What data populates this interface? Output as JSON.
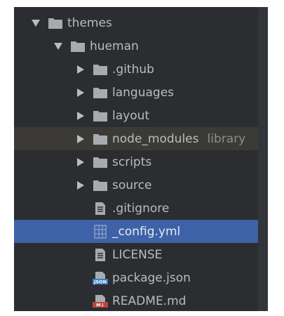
{
  "tree": {
    "items": [
      {
        "label": "themes",
        "type": "folder",
        "expanded": true,
        "depth": 0
      },
      {
        "label": "hueman",
        "type": "folder",
        "expanded": true,
        "depth": 1
      },
      {
        "label": ".github",
        "type": "folder",
        "expanded": false,
        "depth": 2
      },
      {
        "label": "languages",
        "type": "folder",
        "expanded": false,
        "depth": 2
      },
      {
        "label": "layout",
        "type": "folder",
        "expanded": false,
        "depth": 2
      },
      {
        "label": "node_modules",
        "hint": "library",
        "type": "folder",
        "expanded": false,
        "depth": 2
      },
      {
        "label": "scripts",
        "type": "folder",
        "expanded": false,
        "depth": 2
      },
      {
        "label": "source",
        "type": "folder",
        "expanded": false,
        "depth": 2
      },
      {
        "label": ".gitignore",
        "type": "file-text",
        "depth": 2
      },
      {
        "label": "_config.yml",
        "type": "file-yml",
        "depth": 2,
        "selected": true
      },
      {
        "label": "LICENSE",
        "type": "file-text",
        "depth": 2
      },
      {
        "label": "package.json",
        "type": "file-json",
        "icon_text": "JSON",
        "depth": 2
      },
      {
        "label": "README.md",
        "type": "file-md",
        "icon_text": "M↓",
        "depth": 2
      }
    ]
  },
  "colors": {
    "panel_bg": "#2b2d30",
    "selected_bg": "#3d62a8",
    "library_row_bg": "#3b3a36",
    "text": "#b9bcc1",
    "folder_icon": "#a7abb0",
    "json_icon": "#3a7fc8",
    "md_icon": "#c0433d"
  }
}
